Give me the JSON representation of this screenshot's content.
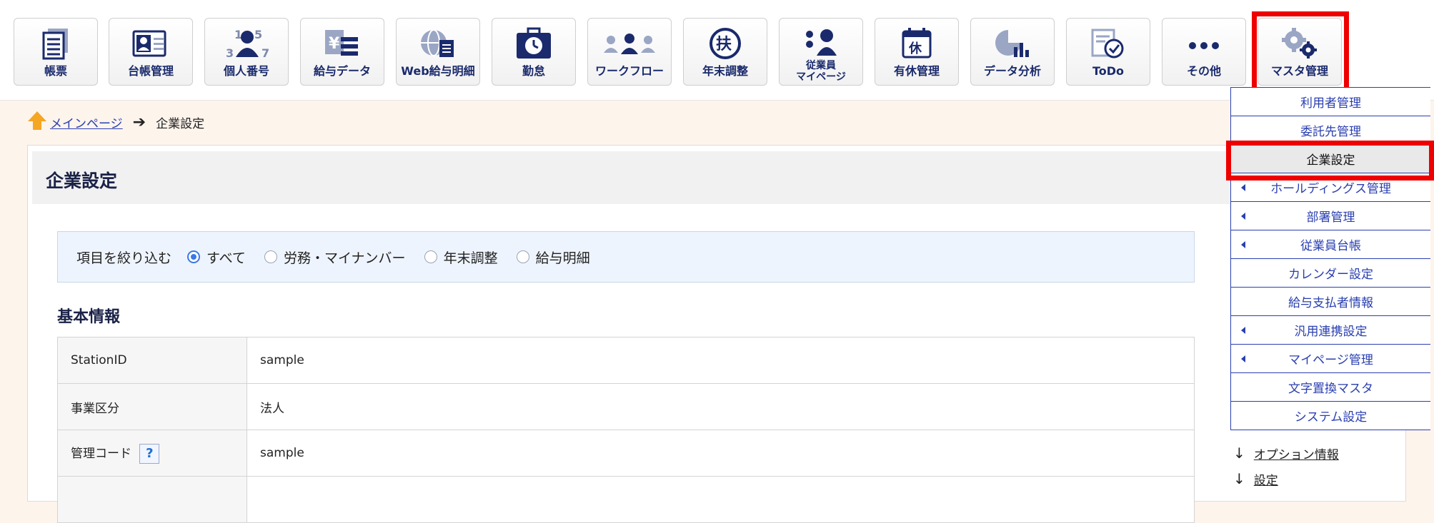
{
  "toolbar": {
    "items": [
      {
        "label": "帳票",
        "icon": "document-list-icon"
      },
      {
        "label": "台帳管理",
        "icon": "id-card-icon"
      },
      {
        "label": "個人番号",
        "icon": "person-number-icon"
      },
      {
        "label": "給与データ",
        "icon": "yen-data-icon"
      },
      {
        "label": "Web給与明細",
        "icon": "globe-document-icon"
      },
      {
        "label": "勤怠",
        "icon": "clock-briefcase-icon"
      },
      {
        "label": "ワークフロー",
        "icon": "people-flow-icon"
      },
      {
        "label": "年末調整",
        "icon": "fu-circle-icon"
      },
      {
        "label": "従業員\nマイページ",
        "icon": "employee-page-icon"
      },
      {
        "label": "有休管理",
        "icon": "calendar-holiday-icon"
      },
      {
        "label": "データ分析",
        "icon": "chart-analysis-icon"
      },
      {
        "label": "ToDo",
        "icon": "todo-check-icon"
      },
      {
        "label": "その他",
        "icon": "more-dots-icon"
      },
      {
        "label": "マスタ管理",
        "icon": "gears-icon"
      }
    ]
  },
  "breadcrumb": {
    "home": "メインページ",
    "current": "企業設定"
  },
  "page": {
    "title": "企業設定"
  },
  "filter": {
    "label": "項目を絞り込む",
    "options": [
      "すべて",
      "労務・マイナンバー",
      "年末調整",
      "給与明細"
    ],
    "selected": "すべて"
  },
  "section": {
    "title": "基本情報"
  },
  "info_table": {
    "rows": [
      {
        "key": "StationID",
        "value": "sample"
      },
      {
        "key": "事業区分",
        "value": "法人"
      },
      {
        "key": "管理コード",
        "value": "sample",
        "help": "?"
      }
    ]
  },
  "master_menu": {
    "items": [
      {
        "label": "利用者管理",
        "submenu": false
      },
      {
        "label": "委託先管理",
        "submenu": false
      },
      {
        "label": "企業設定",
        "submenu": false,
        "active": true
      },
      {
        "label": "ホールディングス管理",
        "submenu": true
      },
      {
        "label": "部署管理",
        "submenu": true
      },
      {
        "label": "従業員台帳",
        "submenu": true
      },
      {
        "label": "カレンダー設定",
        "submenu": false
      },
      {
        "label": "給与支払者情報",
        "submenu": false
      },
      {
        "label": "汎用連携設定",
        "submenu": true
      },
      {
        "label": "マイページ管理",
        "submenu": true
      },
      {
        "label": "文字置換マスタ",
        "submenu": false
      },
      {
        "label": "システム設定",
        "submenu": false
      }
    ]
  },
  "side_links": {
    "option_info": "オプション情報",
    "settings": "設定"
  },
  "colors": {
    "accent_blue": "#2a3fb0",
    "highlight_red": "#ef0000",
    "radio_blue": "#3b78e7"
  }
}
